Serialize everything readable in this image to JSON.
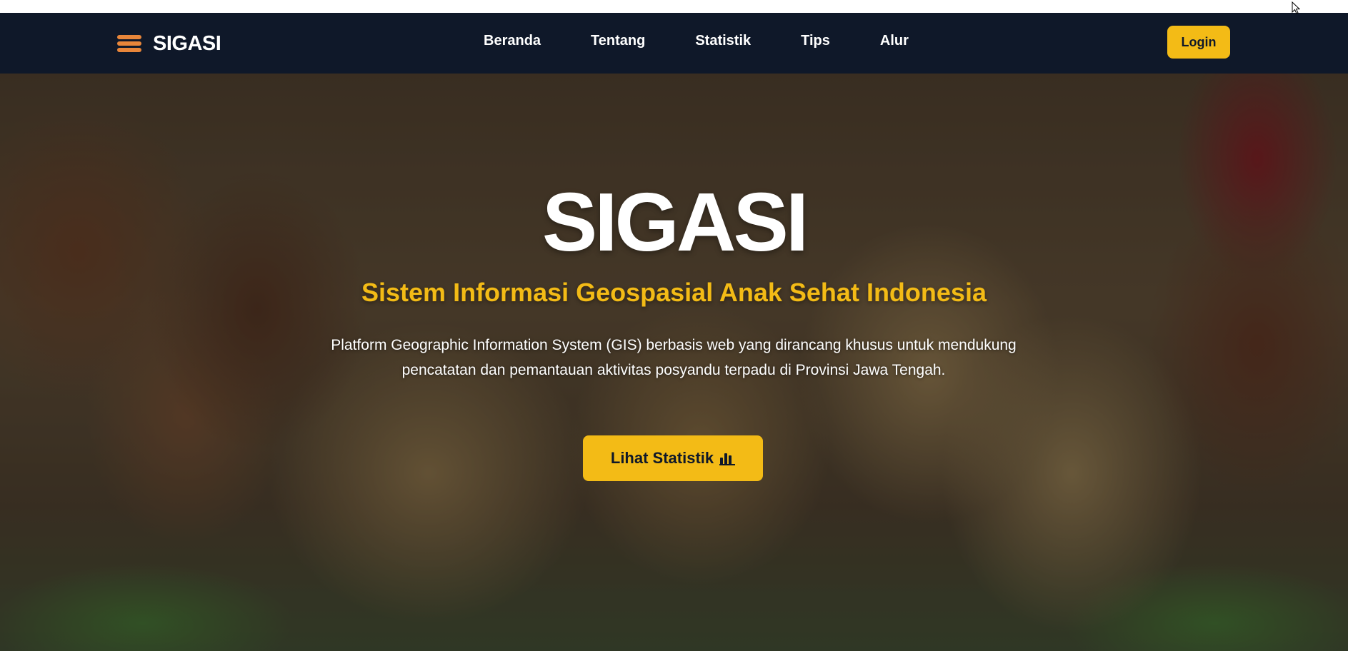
{
  "navbar": {
    "brand": {
      "name": "SIGASI",
      "icon": "stacked-lines-logo-icon"
    },
    "links": [
      {
        "label": "Beranda"
      },
      {
        "label": "Tentang"
      },
      {
        "label": "Statistik"
      },
      {
        "label": "Tips"
      },
      {
        "label": "Alur"
      }
    ],
    "login_label": "Login"
  },
  "hero": {
    "title": "SIGASI",
    "subtitle": "Sistem Informasi Geospasial Anak Sehat Indonesia",
    "description": "Platform Geographic Information System (GIS) berbasis web yang dirancang khusus untuk mendukung pencatatan dan pemantauan aktivitas posyandu terpadu di Provinsi Jawa Tengah.",
    "cta_label": "Lihat Statistik",
    "cta_icon": "bar-chart-icon",
    "background_image": "photo-of-smiling-schoolchildren-icon"
  },
  "colors": {
    "navbar_bg": "#0f1829",
    "accent": "#f3bb16",
    "logo": "#e8863a",
    "text_light": "#ffffff"
  }
}
